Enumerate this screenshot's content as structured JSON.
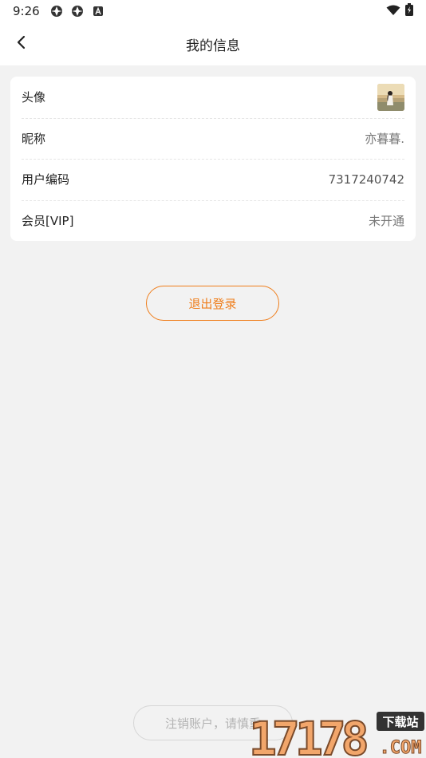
{
  "status_bar": {
    "time": "9:26",
    "icons": [
      "app-icon",
      "app-icon",
      "a-icon",
      "wifi-icon",
      "battery-icon"
    ]
  },
  "nav": {
    "title": "我的信息",
    "back_icon": "chevron-left-icon"
  },
  "profile": {
    "rows": [
      {
        "label": "头像",
        "value": ""
      },
      {
        "label": "昵称",
        "value": "亦暮暮."
      },
      {
        "label": "用户编码",
        "value": "7317240742"
      },
      {
        "label": "会员[VIP]",
        "value": "未开通"
      }
    ]
  },
  "actions": {
    "logout_label": "退出登录",
    "delete_account_label": "注销账户，请慎重"
  },
  "watermark": {
    "text": "17178",
    "tag": "下载站",
    "domain": ".COM"
  },
  "colors": {
    "accent": "#ef7d1a",
    "background": "#f2f2f2",
    "card": "#ffffff"
  }
}
